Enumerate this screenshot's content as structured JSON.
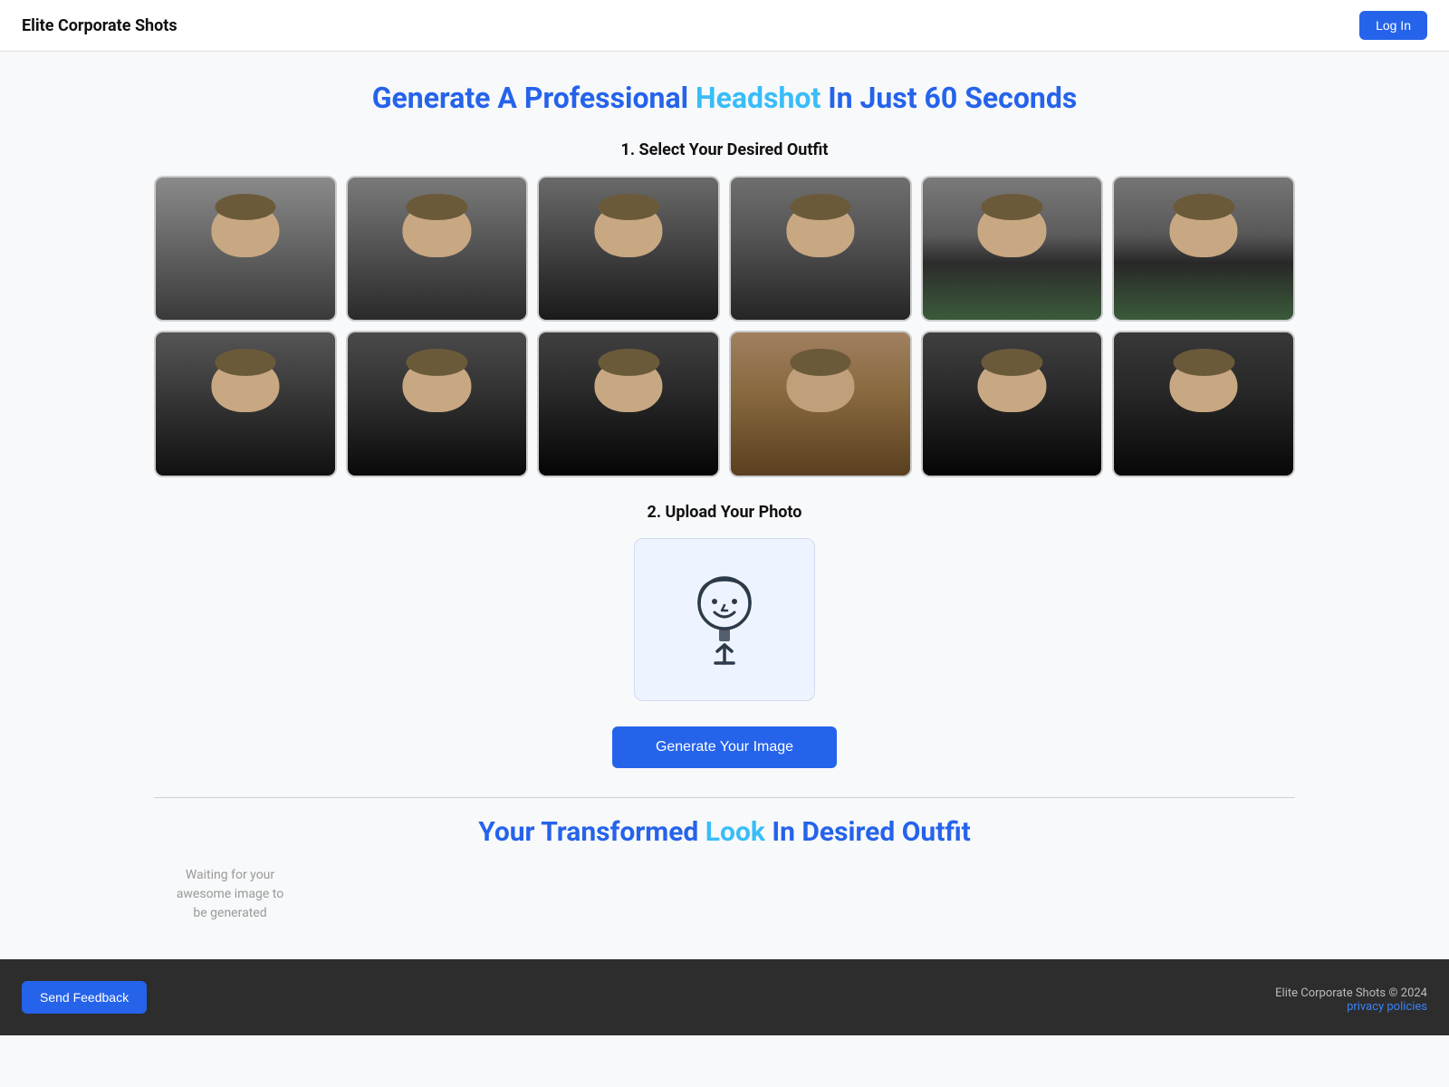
{
  "header": {
    "title": "Elite Corporate Shots",
    "login_label": "Log In"
  },
  "hero": {
    "title_part1": "Generate A Professional ",
    "title_highlight": "Headshot",
    "title_part2": " In Just 60 Seconds"
  },
  "step1": {
    "label": "1. Select Your Desired Outfit"
  },
  "step2": {
    "label": "2. Upload Your Photo"
  },
  "generate_button": {
    "label": "Generate Your Image"
  },
  "transformed": {
    "title_part1": "Your Transformed ",
    "title_highlight": "Look",
    "title_part2": " In Desired Outfit",
    "waiting_text": "Waiting for your awesome image to be generated"
  },
  "footer": {
    "send_feedback_label": "Send Feedback",
    "copyright": "Elite Corporate Shots © 2024",
    "privacy_label": "privacy policies"
  }
}
